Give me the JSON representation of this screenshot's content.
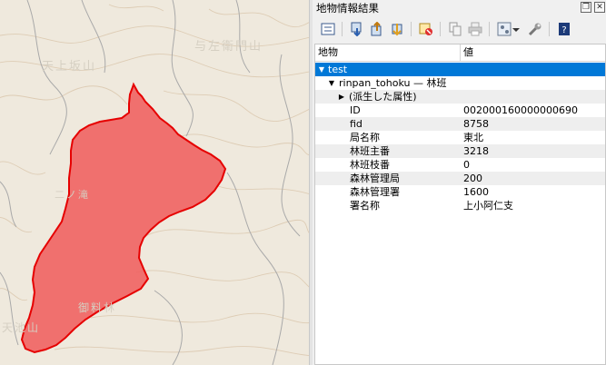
{
  "map": {
    "labels": [
      "与左衛門山",
      "天上坂山",
      "二ノ滝",
      "御料林",
      "天池山"
    ]
  },
  "panel": {
    "title": "地物情報結果",
    "float_icon": "float-panel-icon",
    "close_icon": "close-panel-icon"
  },
  "toolbar": {
    "icons": [
      "expand-tree-icon",
      "expand-all-icon",
      "collapse-all-icon",
      "expand-new-icon",
      "clear-results-icon",
      "copy-feature-icon",
      "print-icon",
      "select-mode-icon",
      "dropdown-arrow-icon",
      "settings-wrench-icon",
      "help-icon"
    ],
    "colors": {
      "accent": "#0078d7",
      "polygon_fill": "#f05a5a",
      "polygon_stroke": "#e60000"
    }
  },
  "tree": {
    "headers": {
      "feature": "地物",
      "value": "値"
    },
    "layer": {
      "name": "test"
    },
    "feature": {
      "label": "rinpan_tohoku — 林班"
    },
    "derived": {
      "label": "(派生した属性)"
    },
    "attributes": [
      {
        "name": "ID",
        "value": "002000160000000690"
      },
      {
        "name": "fid",
        "value": "8758"
      },
      {
        "name": "局名称",
        "value": "東北"
      },
      {
        "name": "林班主番",
        "value": "3218"
      },
      {
        "name": "林班枝番",
        "value": "0"
      },
      {
        "name": "森林管理局",
        "value": "200"
      },
      {
        "name": "森林管理署",
        "value": "1600"
      },
      {
        "name": "署名称",
        "value": "上小阿仁支"
      }
    ]
  }
}
